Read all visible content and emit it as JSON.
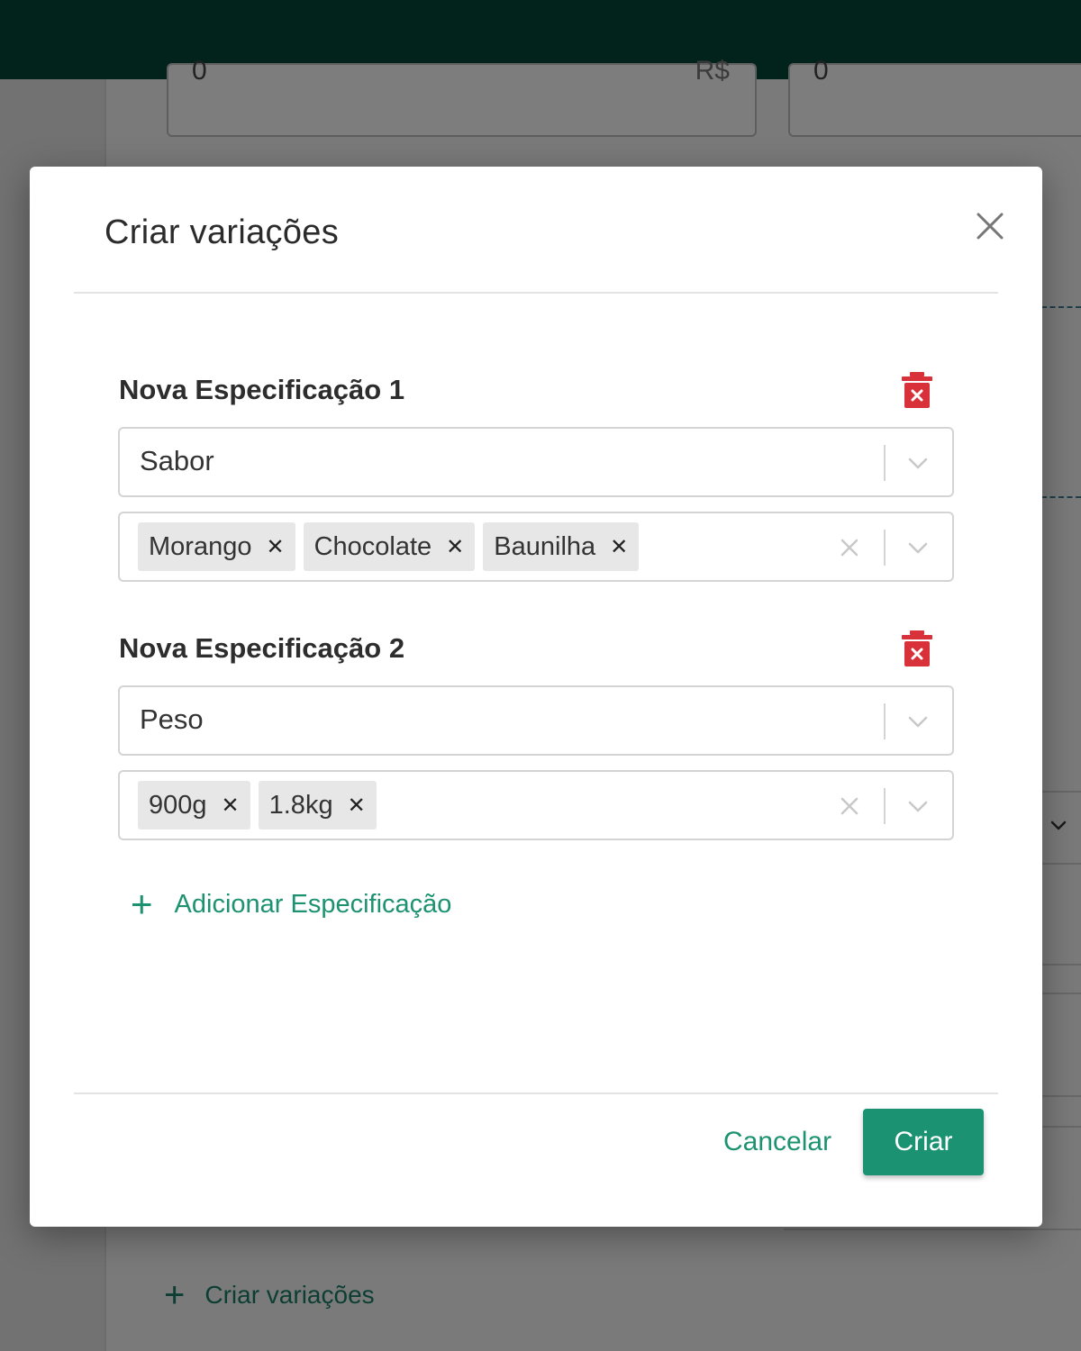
{
  "background": {
    "price_input": {
      "value": "0",
      "suffix": "R$"
    },
    "second_input": {
      "value": "0"
    },
    "create_variations_label": "Criar variações"
  },
  "modal": {
    "title": "Criar variações",
    "specs": [
      {
        "title": "Nova Especificação 1",
        "attribute": "Sabor",
        "values": [
          "Morango",
          "Chocolate",
          "Baunilha"
        ]
      },
      {
        "title": "Nova Especificação 2",
        "attribute": "Peso",
        "values": [
          "900g",
          "1.8kg"
        ]
      }
    ],
    "add_spec_label": "Adicionar Especificação",
    "cancel_label": "Cancelar",
    "create_label": "Criar"
  },
  "colors": {
    "accent": "#1b9272",
    "danger": "#d9313a",
    "topbar": "#02231b"
  }
}
